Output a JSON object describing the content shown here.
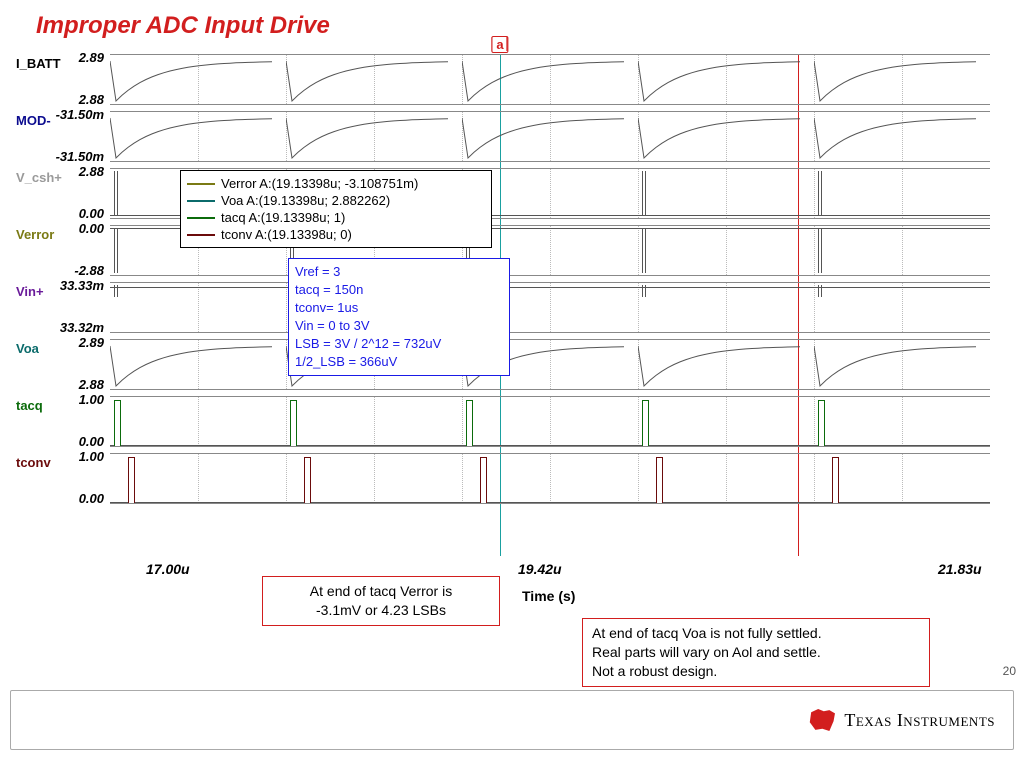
{
  "title": "Improper ADC Input Drive",
  "cursor_label": "a",
  "panes": [
    {
      "name": "I_BATT",
      "color": "#000",
      "ytop": "2.89",
      "ybot": "2.88",
      "type": "exp"
    },
    {
      "name": "MOD-",
      "color": "#0b0b8f",
      "ytop": "-31.50m",
      "ybot": "-31.50m",
      "type": "exp"
    },
    {
      "name": "V_csh+",
      "color": "#9a9a9a",
      "ytop": "2.88",
      "ybot": "0.00",
      "type": "glitch"
    },
    {
      "name": "Verror",
      "color": "#7a7a14",
      "ytop": "0.00",
      "ybot": "-2.88",
      "type": "glitch_neg"
    },
    {
      "name": "Vin+",
      "color": "#6a1b9a",
      "ytop": "33.33m",
      "ybot": "33.32m",
      "type": "tinyglitch"
    },
    {
      "name": "Voa",
      "color": "#0b6b6b",
      "ytop": "2.89",
      "ybot": "2.88",
      "type": "exp"
    },
    {
      "name": "tacq",
      "color": "#0b6b0b",
      "ytop": "1.00",
      "ybot": "0.00",
      "type": "pulse"
    },
    {
      "name": "tconv",
      "color": "#6b0b0b",
      "ytop": "1.00",
      "ybot": "0.00",
      "type": "pulse"
    }
  ],
  "xaxis": {
    "t0": "17.00u",
    "t1": "19.42u",
    "t2": "21.83u",
    "label": "Time (s)"
  },
  "legend": [
    {
      "color": "#7a7a14",
      "text": "Verror   A:(19.13398u; -3.108751m)"
    },
    {
      "color": "#0b6b6b",
      "text": "Voa   A:(19.13398u; 2.882262)"
    },
    {
      "color": "#0b6b0b",
      "text": "tacq   A:(19.13398u; 1)"
    },
    {
      "color": "#6b0b0b",
      "text": "tconv   A:(19.13398u; 0)"
    }
  ],
  "params": [
    "Vref = 3",
    "tacq = 150n",
    "tconv= 1us",
    "Vin = 0 to 3V",
    "LSB = 3V / 2^12 = 732uV",
    "1/2_LSB = 366uV"
  ],
  "note1_l1": "At end of tacq Verror is",
  "note1_l2": "-3.1mV or 4.23 LSBs",
  "note2_l1": "At end of tacq Voa is not fully settled.",
  "note2_l2": "Real parts will vary on Aol and settle.",
  "note2_l3": "Not a robust design.",
  "slidenum": "20",
  "brand": "Texas Instruments",
  "chart_data": {
    "type": "line",
    "title": "Improper ADC Input Drive",
    "xlabel": "Time (s)",
    "xrange_us": [
      17.0,
      21.83
    ],
    "cursor_a_us": 19.13398,
    "period_us": 1.15,
    "cycles_visible": 5,
    "series": [
      {
        "name": "I_BATT",
        "ylim": [
          2.88,
          2.89
        ],
        "shape": "sawtooth_exp_recover"
      },
      {
        "name": "MOD-",
        "ylim": [
          -0.0315,
          -0.0315
        ],
        "shape": "sawtooth_exp_recover"
      },
      {
        "name": "V_csh+",
        "ylim": [
          0,
          2.88
        ],
        "shape": "narrow_positive_glitch_each_cycle"
      },
      {
        "name": "Verror",
        "ylim": [
          -2.88,
          0
        ],
        "shape": "narrow_negative_glitch_each_cycle",
        "value_at_cursor": -0.003108751
      },
      {
        "name": "Vin+",
        "ylim": [
          0.03332,
          0.03333
        ],
        "shape": "tiny_dip_each_cycle"
      },
      {
        "name": "Voa",
        "ylim": [
          2.88,
          2.89
        ],
        "shape": "sawtooth_exp_recover",
        "value_at_cursor": 2.882262
      },
      {
        "name": "tacq",
        "ylim": [
          0,
          1
        ],
        "shape": "short_high_pulse_each_cycle",
        "duty": 0.13,
        "value_at_cursor": 1
      },
      {
        "name": "tconv",
        "ylim": [
          0,
          1
        ],
        "shape": "short_high_pulse_each_cycle_offset",
        "duty": 0.13,
        "value_at_cursor": 0
      }
    ],
    "notes": {
      "verror_at_tacq_end_mV": -3.1,
      "verror_at_tacq_end_LSB": 4.23
    }
  }
}
